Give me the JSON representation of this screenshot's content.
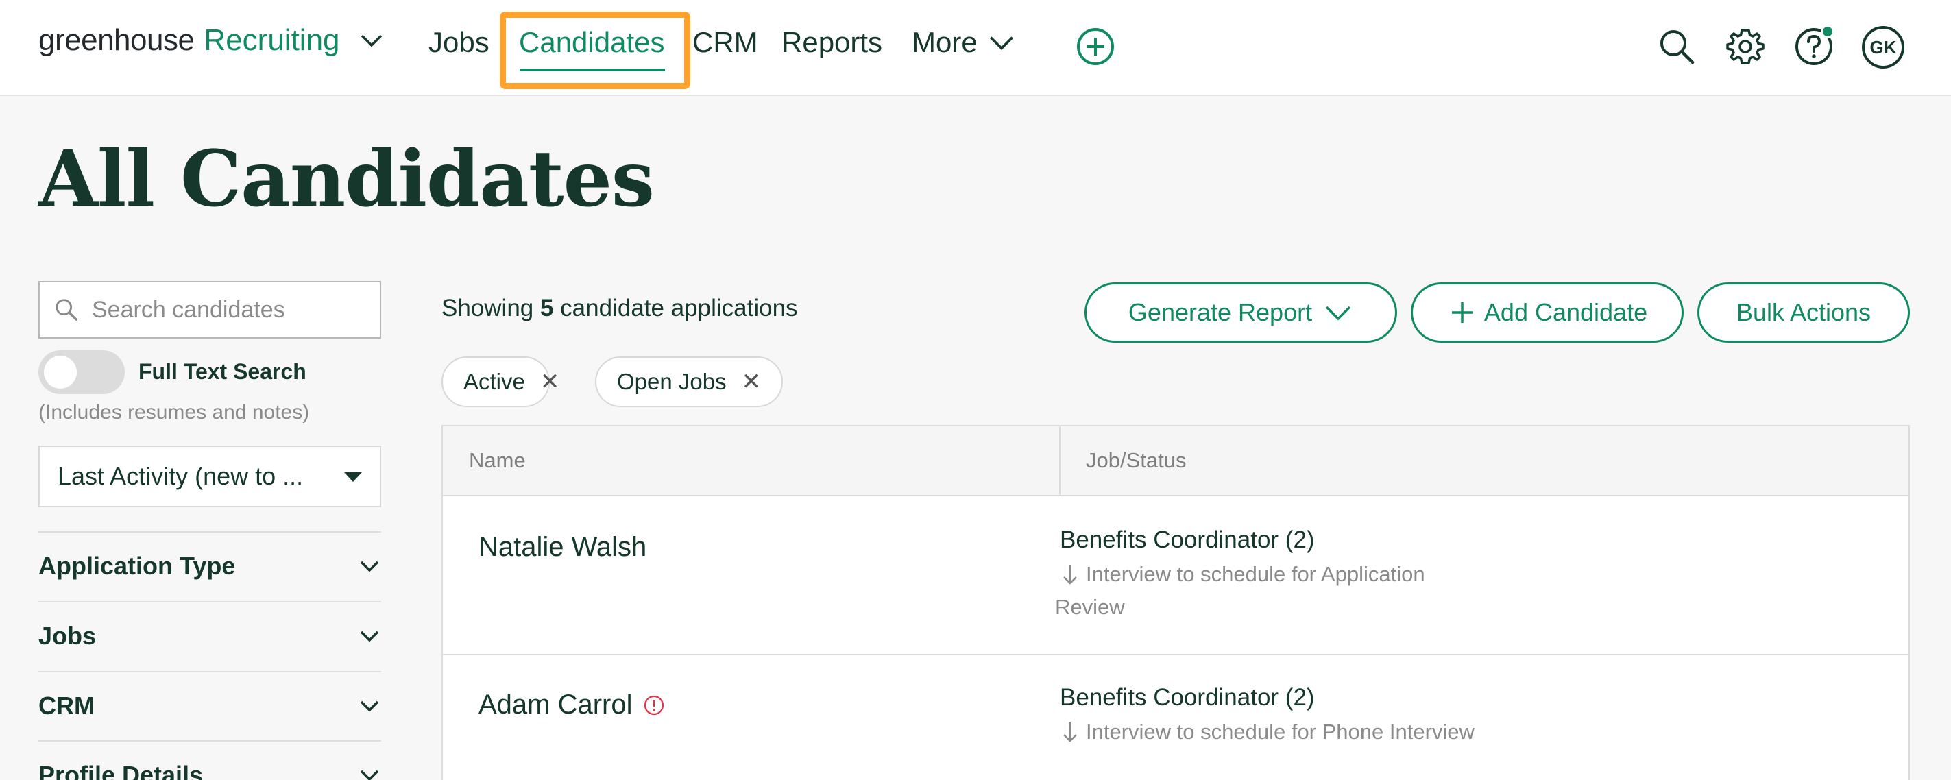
{
  "app": {
    "brand": "greenhouse",
    "product": "Recruiting"
  },
  "nav": {
    "jobs": "Jobs",
    "candidates": "Candidates",
    "crm": "CRM",
    "reports": "Reports",
    "more": "More",
    "user_initials": "GK"
  },
  "colors": {
    "accent": "#0f8b5f",
    "text": "#15372c",
    "highlight": "#ffa22e",
    "alert": "#e0344a"
  },
  "page": {
    "title": "All Candidates"
  },
  "sidebar": {
    "search_placeholder": "Search candidates",
    "full_text_label": "Full Text Search",
    "full_text_note": "(Includes resumes and notes)",
    "full_text_on": false,
    "sort_value": "Last Activity (new to ...",
    "filters": [
      "Application Type",
      "Jobs",
      "CRM",
      "Profile Details"
    ]
  },
  "main": {
    "showing_prefix": "Showing ",
    "showing_count": "5",
    "showing_suffix": " candidate applications",
    "buttons": {
      "generate_report": "Generate Report",
      "add_candidate": "Add Candidate",
      "bulk_actions": "Bulk Actions"
    },
    "chips": [
      "Active",
      "Open Jobs"
    ],
    "columns": {
      "name": "Name",
      "job_status": "Job/Status"
    },
    "rows": [
      {
        "name": "Natalie Walsh",
        "job": "Benefits Coordinator (2)",
        "stage_line1": "Interview to schedule for Application",
        "stage_line2": "Review"
      },
      {
        "name": "Adam Carrol",
        "job": "Benefits Coordinator (2)",
        "stage_line1": "Interview to schedule for Phone Interview"
      }
    ]
  }
}
